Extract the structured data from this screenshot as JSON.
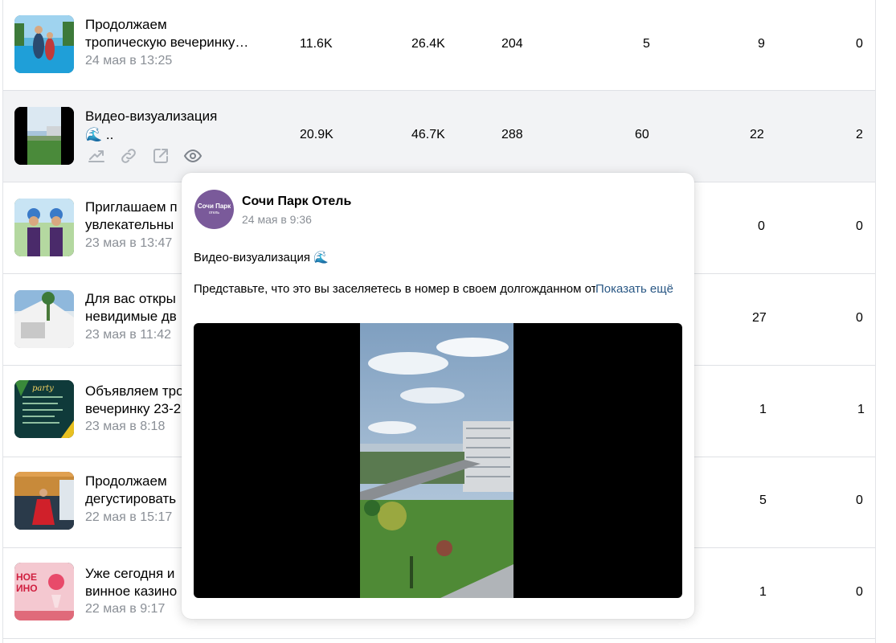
{
  "rows": [
    {
      "title1": "Продолжаем",
      "title2": "тропическую вечеринку…",
      "date": "24 мая в 13:25",
      "c1": "11.6K",
      "c2": "26.4K",
      "c3": "204",
      "c4": "5",
      "c5": "9",
      "c6": "0"
    },
    {
      "title1": "Видео-визуализация",
      "title2": "🌊 ..",
      "date": "",
      "c1": "20.9K",
      "c2": "46.7K",
      "c3": "288",
      "c4": "60",
      "c5": "22",
      "c6": "2"
    },
    {
      "title1": "Приглашаем п",
      "title2": "увлекательны",
      "date": "23 мая в 13:47",
      "c5": "0",
      "c6": "0"
    },
    {
      "title1": "Для вас откры",
      "title2": "невидимые дв",
      "date": "23 мая в 11:42",
      "c5": "27",
      "c6": "0"
    },
    {
      "title1": "Объявляем тро",
      "title2": "вечеринку 23-2",
      "date": "23 мая в 8:18",
      "c5": "1",
      "c6": "1"
    },
    {
      "title1": "Продолжаем",
      "title2": "дегустировать",
      "date": "22 мая в 15:17",
      "c5": "5",
      "c6": "0"
    },
    {
      "title1": "Уже сегодня и",
      "title2": "винное казино",
      "date": "22 мая в 9:17",
      "c5": "1",
      "c6": "0"
    }
  ],
  "thumb_text": {
    "party": "party",
    "wine1": "НОЕ",
    "wine2": "ИНО"
  },
  "popup": {
    "avatar": "Сочи Парк",
    "avatar_sub": "отель",
    "name": "Сочи Парк Отель",
    "date": "24 мая в 9:36",
    "title": "Видео-визуализация 🌊",
    "text": "Представьте, что это вы заселяетесь в номер в своем долгожданном отпуске",
    "more": "Показать ещё"
  },
  "icons": [
    "stats-icon",
    "link-icon",
    "share-icon",
    "eye-icon"
  ],
  "colors": {
    "accent": "#2a5885",
    "avatar": "#7a5a9a",
    "row_highlight": "#f2f3f5"
  }
}
